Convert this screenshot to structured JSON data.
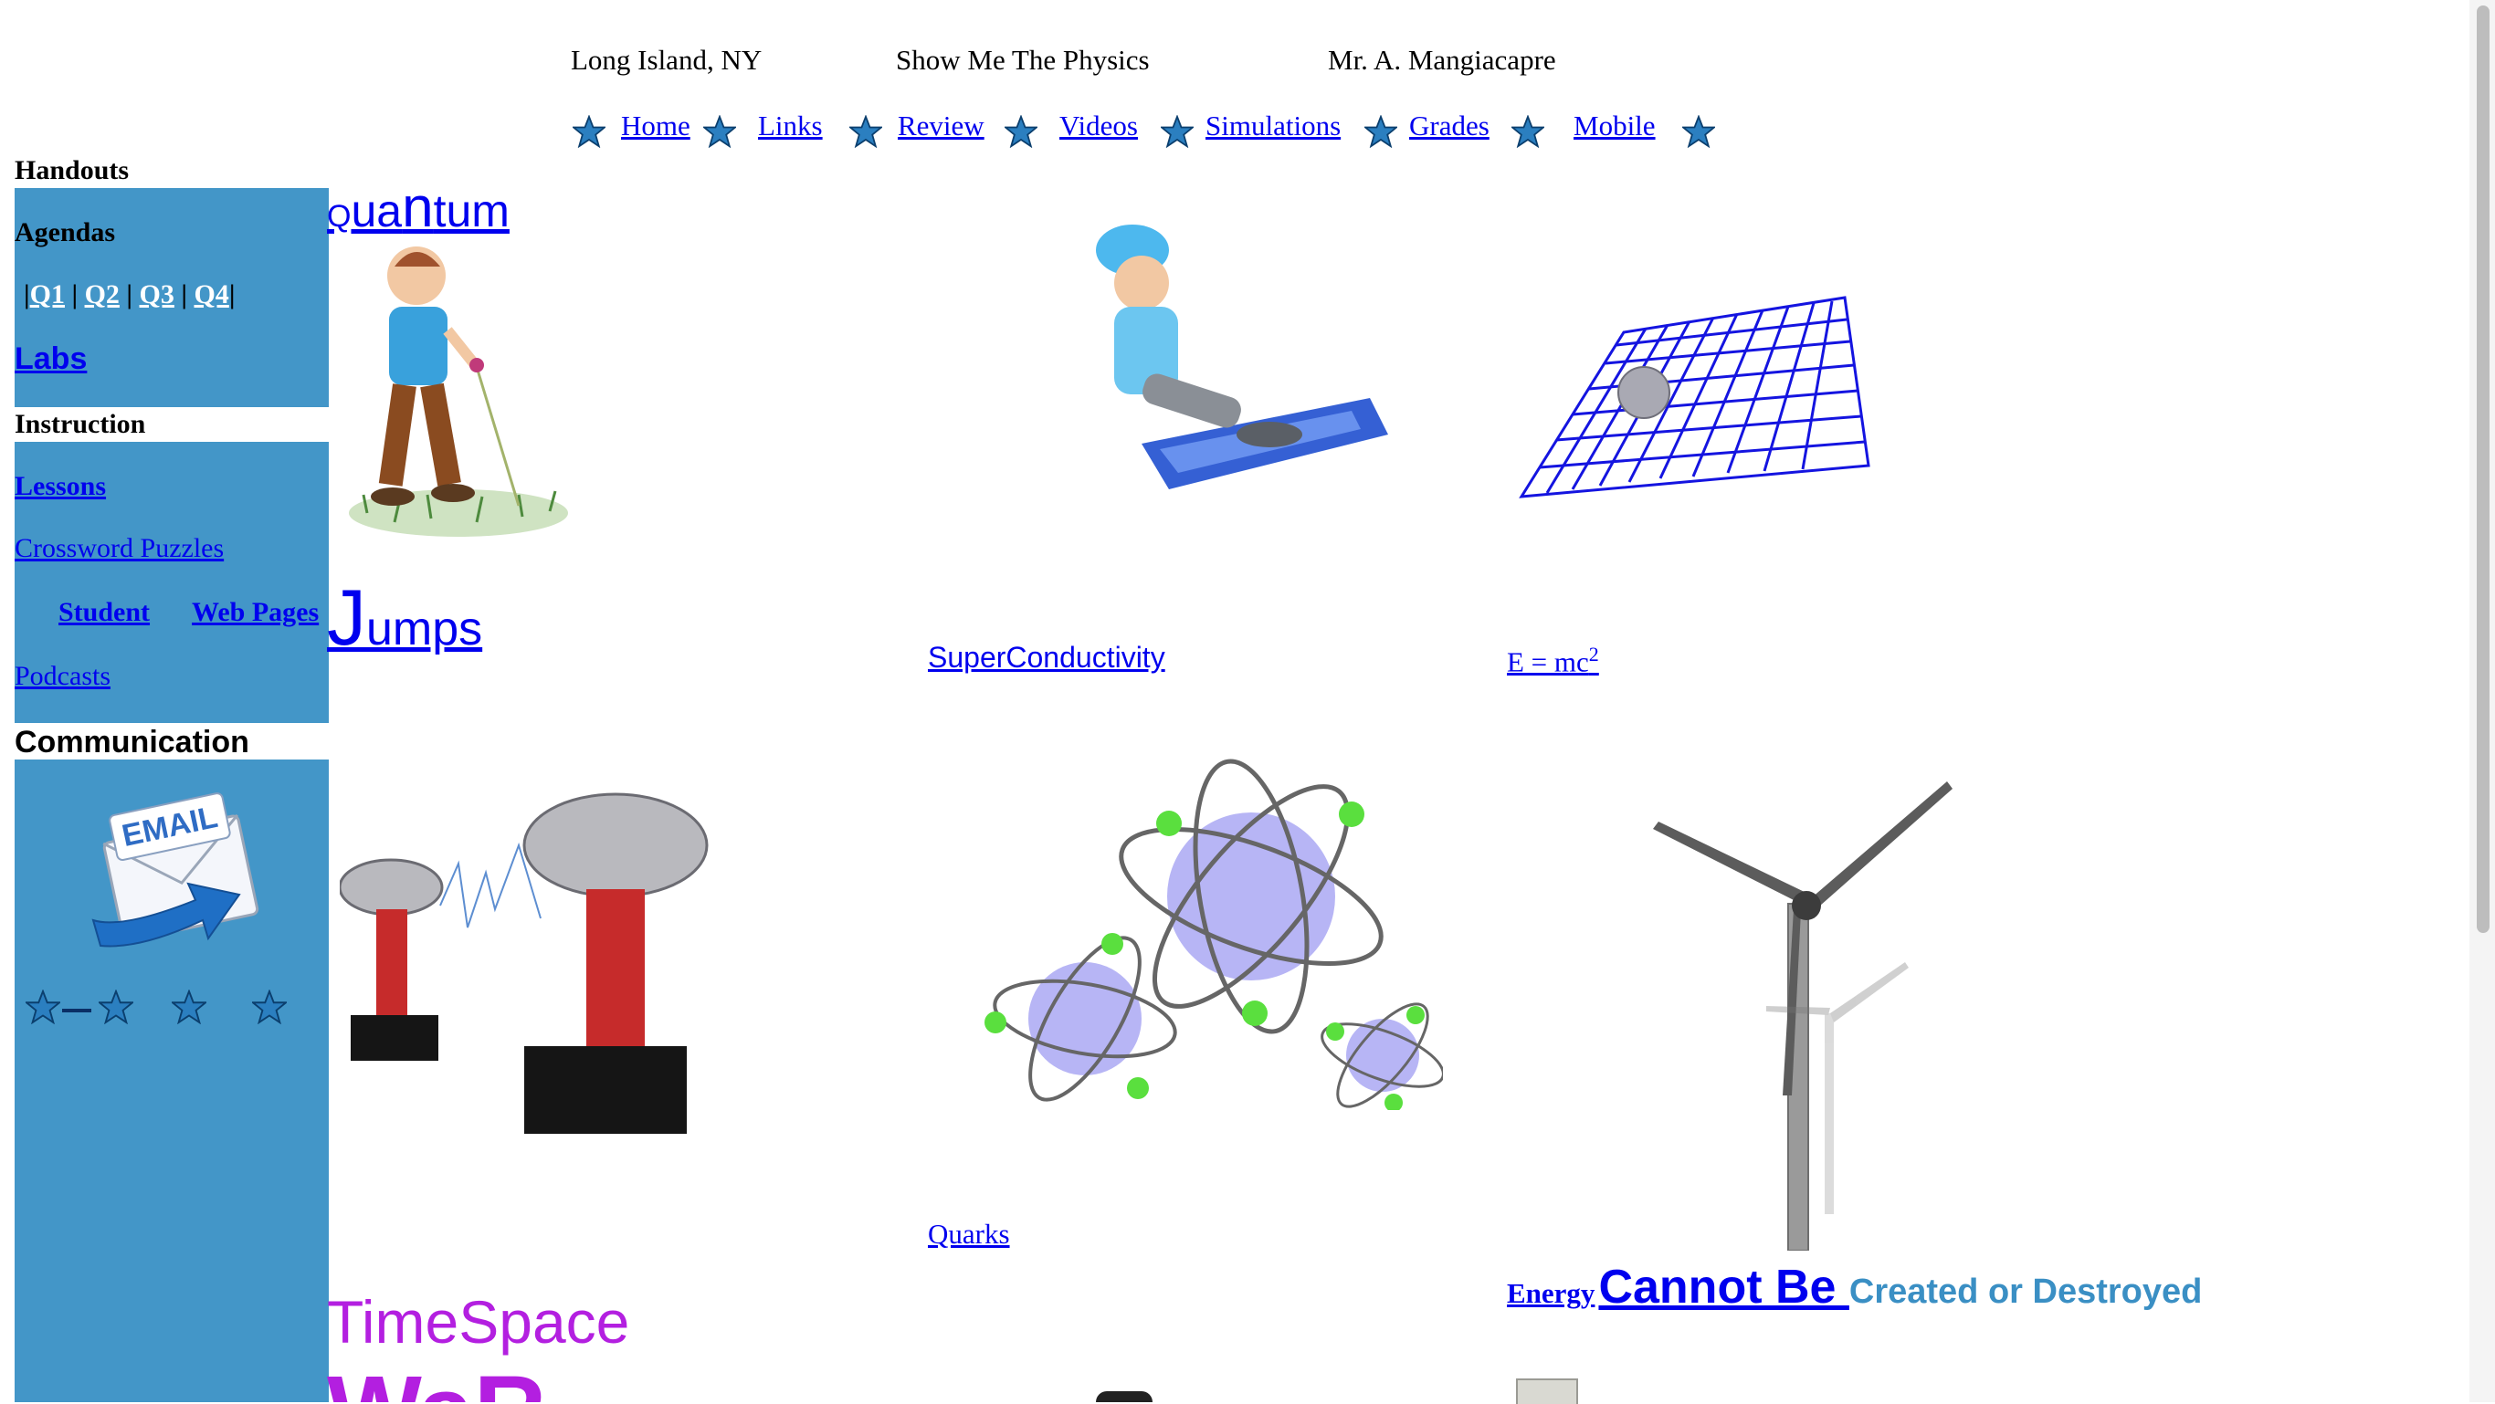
{
  "header": {
    "location": "Long Island, NY",
    "site_title": "Show Me The Physics",
    "teacher": "Mr. A. Mangiacapre"
  },
  "nav": {
    "items": [
      "Home",
      "Links",
      "Review",
      "Videos",
      "Simulations",
      "Grades",
      "Mobile"
    ],
    "separator_icon": "star-icon"
  },
  "sidebar": {
    "handouts_label": "Handouts",
    "agendas_label": "Agendas",
    "quarters": [
      "Q1",
      "Q2",
      "Q3",
      "Q4"
    ],
    "labs_label": "Labs",
    "instruction_label": "Instruction",
    "lessons_label": "Lessons",
    "crossword_label": "Crossword Puzzles",
    "student_label": "Student",
    "web_pages_label": "Web Pages",
    "podcasts_label": "Podcasts",
    "communication_label": "Communication",
    "email_icon_text": "EMAIL",
    "panel_color": "#4396c8"
  },
  "content": {
    "quantum_prefix": "Q",
    "quantum_u": "ua",
    "quantum_n": "n",
    "quantum_tum": "tum",
    "jumps_j": "J",
    "jumps_rest": "umps",
    "superconductivity": "SuperConductivity",
    "emc_base": "E = mc",
    "emc_exp": "2",
    "quarks": "Quarks",
    "energy_word": "Energy",
    "cannot_be": "Cannot Be ",
    "created_destroyed": "Created or Destroyed",
    "timespace": "TimeSpace",
    "warp_partial": "WaR",
    "link_color": "#0000ee",
    "purple": "#b31fe0",
    "teal_blue": "#3a8fc4"
  }
}
